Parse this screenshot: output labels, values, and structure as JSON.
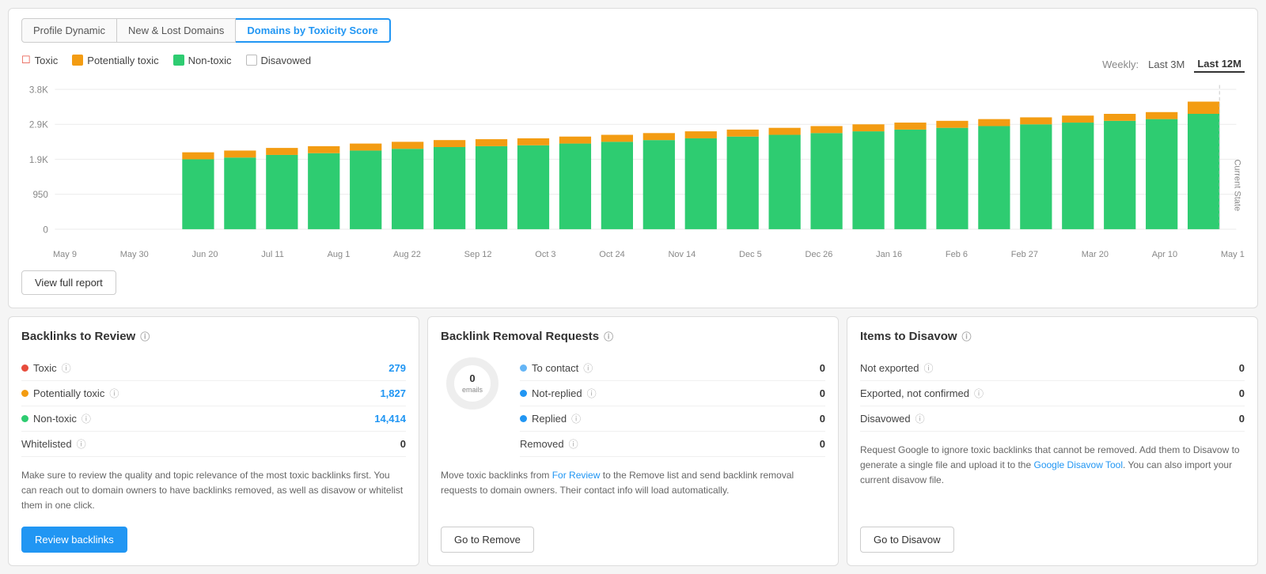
{
  "tabs": [
    {
      "id": "profile-dynamic",
      "label": "Profile Dynamic",
      "active": false
    },
    {
      "id": "new-lost-domains",
      "label": "New & Lost Domains",
      "active": false
    },
    {
      "id": "domains-by-toxicity",
      "label": "Domains by Toxicity Score",
      "active": true
    }
  ],
  "legend": [
    {
      "id": "toxic",
      "label": "Toxic",
      "type": "toxic"
    },
    {
      "id": "potentially",
      "label": "Potentially toxic",
      "type": "potentially"
    },
    {
      "id": "nontoxic",
      "label": "Non-toxic",
      "type": "nontoxic"
    },
    {
      "id": "disavowed",
      "label": "Disavowed",
      "type": "disavowed"
    }
  ],
  "time_controls": {
    "label": "Weekly:",
    "options": [
      "Last 3M",
      "Last 12M"
    ],
    "active": "Last 12M"
  },
  "chart": {
    "y_labels": [
      "3.8K",
      "2.9K",
      "1.9K",
      "950",
      "0"
    ],
    "x_labels": [
      "May 9",
      "May 30",
      "Jun 20",
      "Jul 11",
      "Aug 1",
      "Aug 22",
      "Sep 12",
      "Oct 3",
      "Oct 24",
      "Nov 14",
      "Dec 5",
      "Dec 26",
      "Jan 16",
      "Feb 6",
      "Feb 27",
      "Mar 20",
      "Apr 10",
      "May 1"
    ],
    "current_state": "Current State"
  },
  "view_report_btn": "View full report",
  "cards": {
    "backlinks_to_review": {
      "title": "Backlinks to Review",
      "stats": [
        {
          "id": "toxic",
          "label": "Toxic",
          "value": "279",
          "dot": "red",
          "info": true
        },
        {
          "id": "potentially",
          "label": "Potentially toxic",
          "value": "1,827",
          "dot": "orange",
          "info": true
        },
        {
          "id": "nontoxic",
          "label": "Non-toxic",
          "value": "14,414",
          "dot": "green",
          "info": true
        },
        {
          "id": "whitelisted",
          "label": "Whitelisted",
          "value": "0",
          "dot": null,
          "info": true
        }
      ],
      "description": "Make sure to review the quality and topic relevance of the most toxic backlinks first. You can reach out to domain owners to have backlinks removed, as well as disavow or whitelist them in one click.",
      "btn_label": "Review backlinks",
      "btn_type": "primary"
    },
    "backlink_removal": {
      "title": "Backlink Removal Requests",
      "donut_center": "0",
      "donut_sub": "emails",
      "stats": [
        {
          "id": "to-contact",
          "label": "To contact",
          "value": "0",
          "dot": "lightblue",
          "info": true
        },
        {
          "id": "not-replied",
          "label": "Not-replied",
          "value": "0",
          "dot": "blue",
          "info": true
        },
        {
          "id": "replied",
          "label": "Replied",
          "value": "0",
          "dot": "blue",
          "info": true
        },
        {
          "id": "removed",
          "label": "Removed",
          "value": "0",
          "dot": null,
          "info": true
        }
      ],
      "description": "Move toxic backlinks from For Review to the Remove list and send backlink removal requests to domain owners. Their contact info will load automatically.",
      "for_review_link": "For Review",
      "btn_label": "Go to Remove",
      "btn_type": "normal"
    },
    "items_to_disavow": {
      "title": "Items to Disavow",
      "stats": [
        {
          "id": "not-exported",
          "label": "Not exported",
          "value": "0",
          "info": true
        },
        {
          "id": "exported-not-confirmed",
          "label": "Exported, not confirmed",
          "value": "0",
          "info": true
        },
        {
          "id": "disavowed",
          "label": "Disavowed",
          "value": "0",
          "info": true
        }
      ],
      "description_parts": [
        "Request Google to ignore toxic backlinks that cannot be removed. Add them to Disavow to generate a single file and upload it to the ",
        "Google Disavow Tool",
        ". You can also import your current disavow file."
      ],
      "google_link": "Google Disavow Tool",
      "btn_label": "Go to Disavow",
      "btn_type": "normal"
    }
  }
}
